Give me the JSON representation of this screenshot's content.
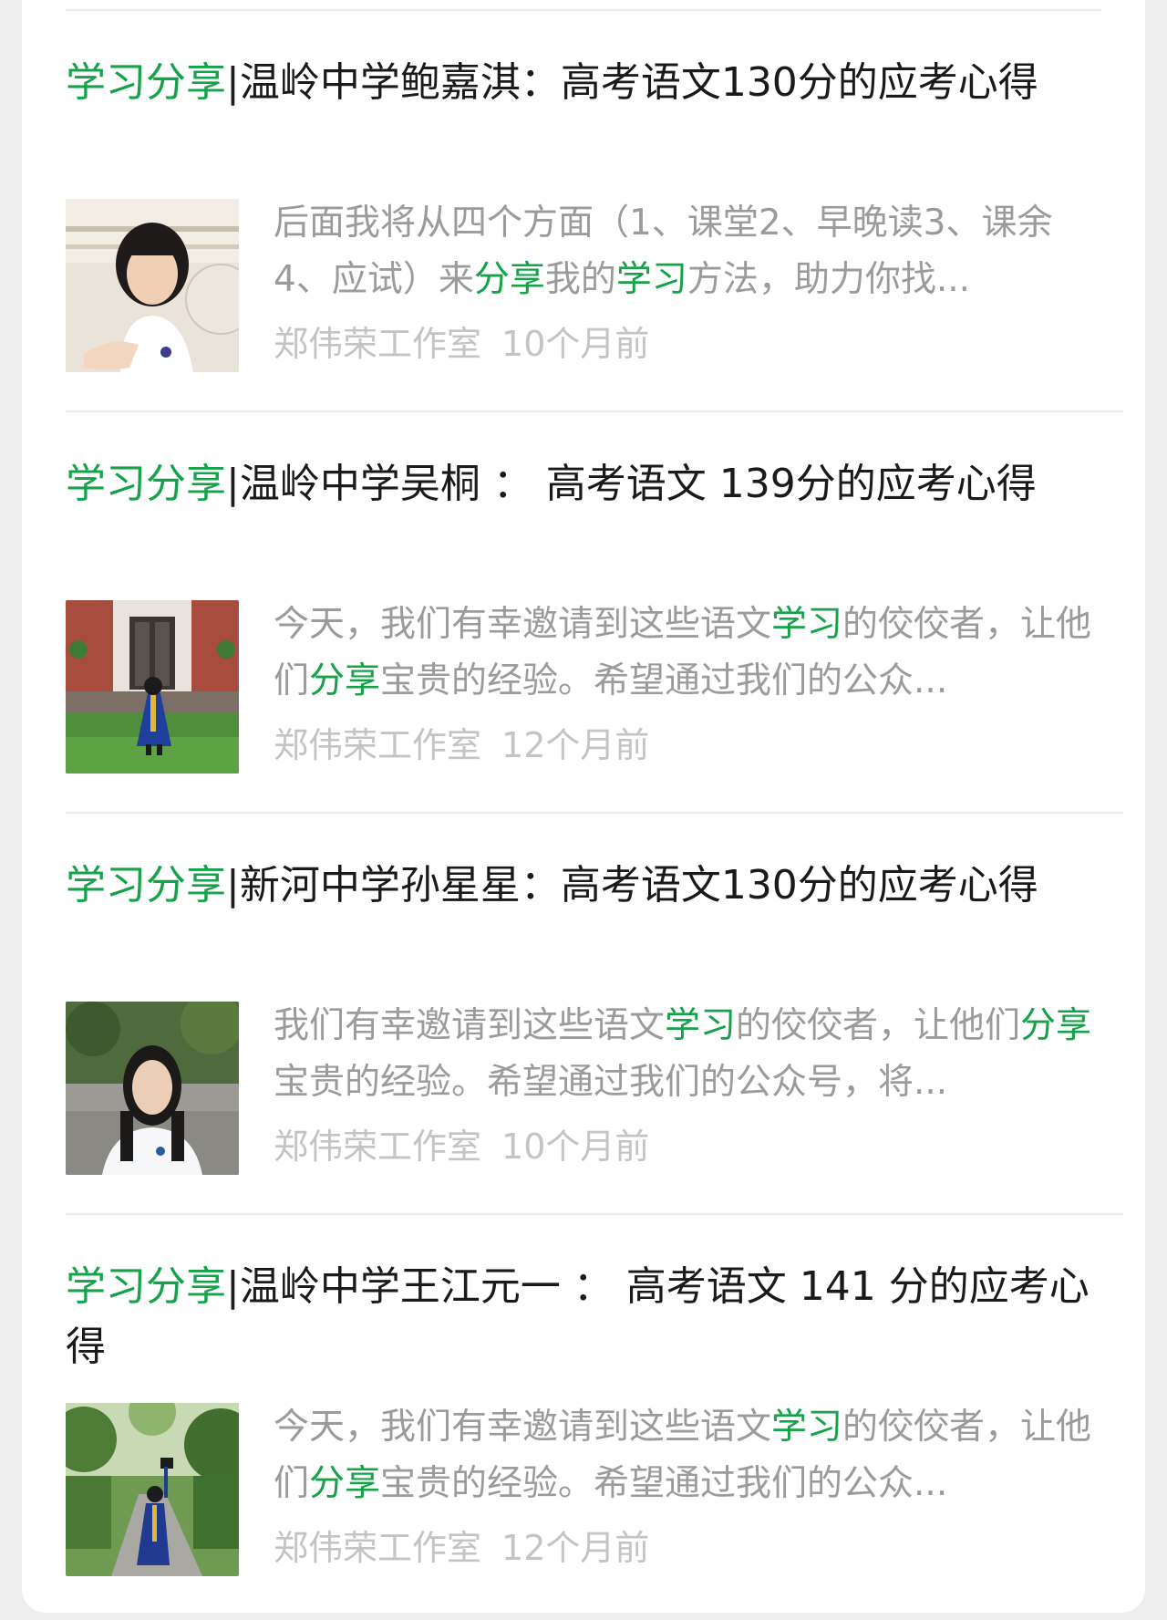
{
  "items": [
    {
      "title_hl": "学习分享",
      "title_rest": "|温岭中学鲍嘉淇：高考语文130分的应考心得",
      "snippet": [
        {
          "t": "后面我将从四个方面（1、课堂2、早晚读3、课余4、应试）来",
          "hl": false
        },
        {
          "t": "分享",
          "hl": true
        },
        {
          "t": "我的",
          "hl": false
        },
        {
          "t": "学习",
          "hl": true
        },
        {
          "t": "方法，助力你找...",
          "hl": false
        }
      ],
      "source": "郑伟荣工作室",
      "time": "10个月前",
      "thumb_icon": "student-portrait-thumbnail"
    },
    {
      "title_hl": "学习分享",
      "title_rest": "|温岭中学吴桐 ： 高考语文 139分的应考心得",
      "snippet": [
        {
          "t": "今天，我们有幸邀请到这些语文",
          "hl": false
        },
        {
          "t": "学习",
          "hl": true
        },
        {
          "t": "的佼佼者，让他们",
          "hl": false
        },
        {
          "t": "分享",
          "hl": true
        },
        {
          "t": "宝贵的经验。希望通过我们的公众...",
          "hl": false
        }
      ],
      "source": "郑伟荣工作室",
      "time": "12个月前",
      "thumb_icon": "graduation-photo-thumbnail"
    },
    {
      "title_hl": "学习分享",
      "title_rest": "|新河中学孙星星：高考语文130分的应考心得",
      "snippet": [
        {
          "t": "我们有幸邀请到这些语文",
          "hl": false
        },
        {
          "t": "学习",
          "hl": true
        },
        {
          "t": "的佼佼者，让他们",
          "hl": false
        },
        {
          "t": "分享",
          "hl": true
        },
        {
          "t": "宝贵的经验。希望通过我们的公众号，将...",
          "hl": false
        }
      ],
      "source": "郑伟荣工作室",
      "time": "10个月前",
      "thumb_icon": "student-portrait-thumbnail"
    },
    {
      "title_hl": "学习分享",
      "title_rest": "|温岭中学王江元一 ： 高考语文 141 分的应考心得",
      "snippet": [
        {
          "t": "今天，我们有幸邀请到这些语文",
          "hl": false
        },
        {
          "t": "学习",
          "hl": true
        },
        {
          "t": "的佼佼者，让他们",
          "hl": false
        },
        {
          "t": "分享",
          "hl": true
        },
        {
          "t": "宝贵的经验。希望通过我们的公众...",
          "hl": false
        }
      ],
      "source": "郑伟荣工作室",
      "time": "12个月前",
      "thumb_icon": "graduation-photo-thumbnail"
    }
  ],
  "colors": {
    "highlight": "#15a34a",
    "title": "#1a1a1a",
    "snippet": "#9b9b9b",
    "meta": "#c4c4c4"
  }
}
